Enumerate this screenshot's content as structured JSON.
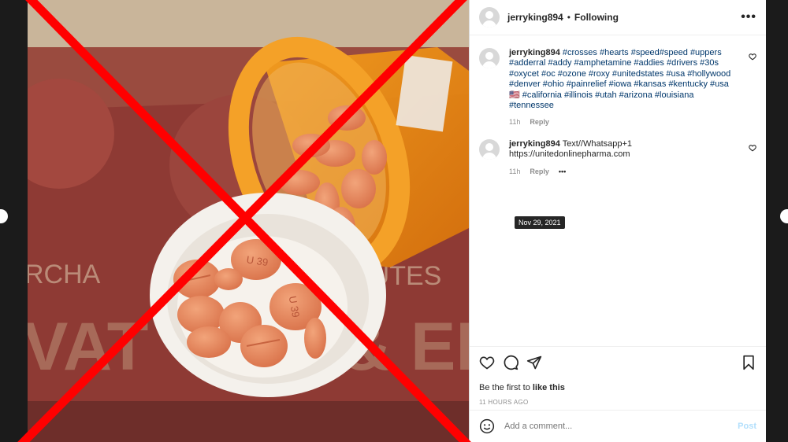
{
  "header": {
    "username": "jerryking894",
    "separator": "•",
    "following": "Following",
    "more": "•••"
  },
  "comments": [
    {
      "username": "jerryking894",
      "text": "#crosses #hearts #speed#speed #uppers #adderral #addy #amphetamine #addies #drivers #30s #oxycet #oc #ozone #roxy #unitedstates #usa #hollywood #denver #ohio #painrelief #iowa #kansas #kentucky #usa🇺🇸 #california #illinois #utah #arizona #louisiana #tennessee",
      "time": "11h",
      "reply": "Reply"
    },
    {
      "username": "jerryking894",
      "text": "Text//Whatsapp+1\nhttps://unitedonlinepharma.com",
      "time": "11h",
      "reply": "Reply",
      "more": "•••"
    }
  ],
  "tooltip": "Nov 29, 2021",
  "likes": {
    "prefix": "Be the first to ",
    "bold": "like this"
  },
  "timestamp": "11 HOURS AGO",
  "add_comment": {
    "placeholder": "Add a comment...",
    "post": "Post"
  },
  "photo": {
    "pill_imprint": "U 39",
    "box_text_left": "RCHA",
    "box_text_right": "BUTES",
    "box_big": "VAT",
    "box_big_right": "& EL"
  },
  "colors": {
    "cross": "#ff0000",
    "link": "#00376b",
    "post": "#b2dffc"
  }
}
